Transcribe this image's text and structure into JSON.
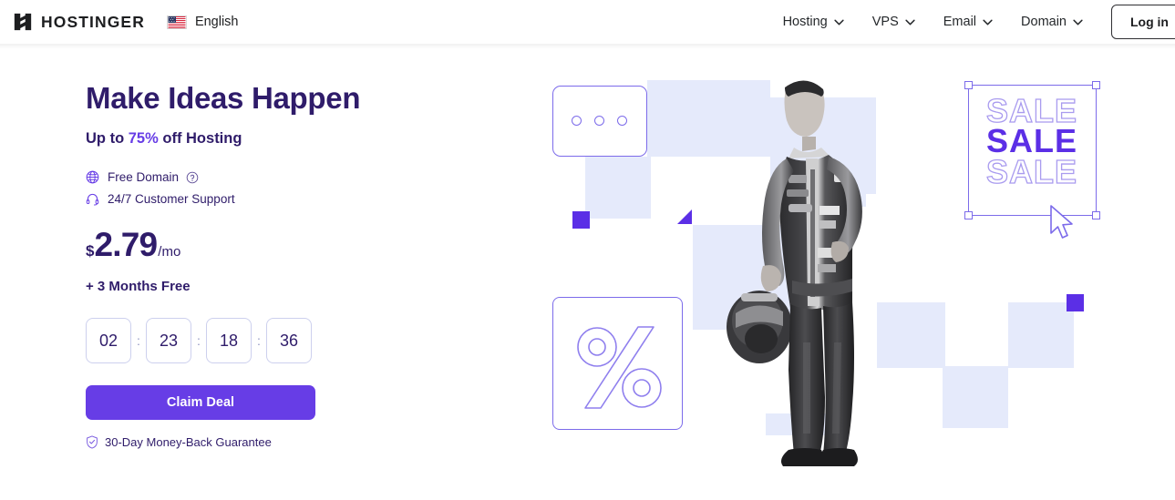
{
  "header": {
    "brand_name": "HOSTINGER",
    "logo_icon": "hostinger-h-logo",
    "language": {
      "label": "English",
      "flag_icon": "us-flag-icon"
    },
    "nav": [
      {
        "label": "Hosting",
        "icon": "chevron-down-icon"
      },
      {
        "label": "VPS",
        "icon": "chevron-down-icon"
      },
      {
        "label": "Email",
        "icon": "chevron-down-icon"
      },
      {
        "label": "Domain",
        "icon": "chevron-down-icon"
      }
    ],
    "login_label": "Log in"
  },
  "hero": {
    "headline": "Make Ideas Happen",
    "subline_prefix": "Up to ",
    "subline_accent": "75%",
    "subline_suffix": " off Hosting",
    "features": [
      {
        "label": "Free Domain",
        "icon": "globe-icon",
        "help_icon": "question-mark-circle-icon"
      },
      {
        "label": "24/7 Customer Support",
        "icon": "headset-icon"
      }
    ],
    "price": {
      "currency": "$",
      "amount": "2.79",
      "period": "/mo"
    },
    "bonus": "+ 3 Months Free",
    "timer": {
      "separator": ":",
      "units": [
        "02",
        "23",
        "18",
        "36"
      ]
    },
    "cta_label": "Claim Deal",
    "guarantee": {
      "label": "30-Day Money-Back Guarantee",
      "icon": "shield-check-icon"
    }
  },
  "art": {
    "browser_card_icon": "browser-window-outline",
    "percent_icon": "percent-symbol-outline",
    "driver_photo": "racing-driver-photo",
    "sale_words": [
      "SALE",
      "SALE",
      "SALE"
    ],
    "cursor_icon": "mouse-cursor-icon"
  },
  "colors": {
    "brand_purple": "#673de6",
    "deep_purple": "#2f1c6a",
    "solid_purple": "#5b2fe6",
    "light_blue": "#e5eafb",
    "outline_purple": "#7c6bea",
    "text_dark": "#1d1e20"
  }
}
